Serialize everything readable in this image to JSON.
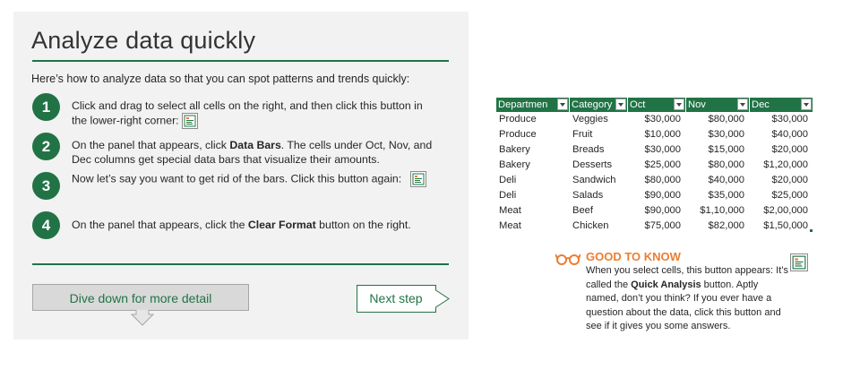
{
  "lesson": {
    "title": "Analyze data quickly",
    "intro": "Here’s how to analyze data so that you can spot patterns and trends quickly:",
    "steps": [
      {
        "number": "1",
        "text": "Click and drag to select all cells on the right, and then click this button in the lower-right corner:"
      },
      {
        "number": "2",
        "text_before": "On the panel that appears, click ",
        "bold": "Data Bars",
        "text_after": ". The cells under Oct, Nov, and Dec columns get special data bars that visualize their amounts."
      },
      {
        "number": "3",
        "text": "Now let’s say you want to get rid of the bars. Click this button again:"
      },
      {
        "number": "4",
        "text_before": "On the panel that appears, click the ",
        "bold": "Clear Format",
        "text_after": " button on the right."
      }
    ],
    "dive_button": "Dive down for more detail",
    "next_button": "Next step",
    "accent_color": "#217346"
  },
  "table": {
    "headers": [
      "Departmen",
      "Category",
      "Oct",
      "Nov",
      "Dec"
    ],
    "rows": [
      [
        "Produce",
        "Veggies",
        "$30,000",
        "$80,000",
        "$30,000"
      ],
      [
        "Produce",
        "Fruit",
        "$10,000",
        "$30,000",
        "$40,000"
      ],
      [
        "Bakery",
        "Breads",
        "$30,000",
        "$15,000",
        "$20,000"
      ],
      [
        "Bakery",
        "Desserts",
        "$25,000",
        "$80,000",
        "$1,20,000"
      ],
      [
        "Deli",
        "Sandwich",
        "$80,000",
        "$40,000",
        "$20,000"
      ],
      [
        "Deli",
        "Salads",
        "$90,000",
        "$35,000",
        "$25,000"
      ],
      [
        "Meat",
        "Beef",
        "$90,000",
        "$1,10,000",
        "$2,00,000"
      ],
      [
        "Meat",
        "Chicken",
        "$75,000",
        "$82,000",
        "$1,50,000"
      ]
    ]
  },
  "good_to_know": {
    "title": "GOOD TO KNOW",
    "text_before": "When you select cells, this button appears: It’s called the ",
    "bold": "Quick Analysis",
    "text_after": " button. Aptly named, don’t you think? If you ever have a question about the data, click this button and see if it gives you some answers.",
    "accent_color": "#ed7d31"
  },
  "icons": [
    "quick-analysis-icon",
    "glasses-icon",
    "dropdown-arrow-icon",
    "arrow-down-icon",
    "arrow-right-icon"
  ]
}
